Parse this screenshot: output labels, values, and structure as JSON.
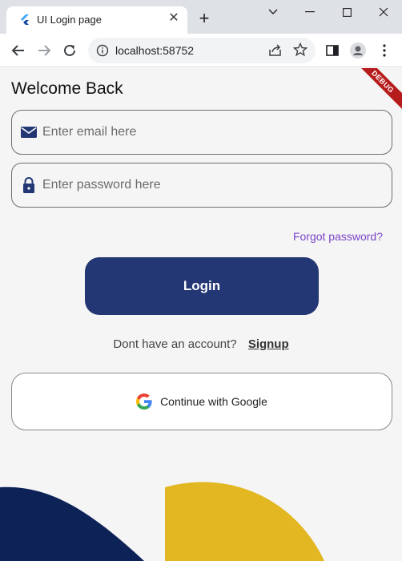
{
  "browser": {
    "tab_title": "UI Login page",
    "url": "localhost:58752"
  },
  "app": {
    "debug_banner": "DEBUG",
    "title": "Welcome Back",
    "email": {
      "placeholder": "Enter email here",
      "value": ""
    },
    "password": {
      "placeholder": "Enter password here",
      "value": ""
    },
    "forgot_password": "Forgot password?",
    "login_button": "Login",
    "signup_prompt": "Dont have an account?",
    "signup_link": "Signup",
    "google_button": "Continue with Google"
  },
  "colors": {
    "primary": "#223774",
    "link_purple": "#7a44c8",
    "accent_yellow": "#e2b722",
    "navy_shape": "#0d2358",
    "debug_red": "#b71c1c"
  },
  "icons": [
    "flutter-logo-icon",
    "close-icon",
    "plus-icon",
    "chevron-down-icon",
    "minimize-icon",
    "maximize-icon",
    "window-close-icon",
    "back-arrow-icon",
    "forward-arrow-icon",
    "reload-icon",
    "info-icon",
    "share-icon",
    "star-icon",
    "sidebar-icon",
    "profile-icon",
    "more-vert-icon",
    "mail-icon",
    "lock-icon",
    "google-icon"
  ]
}
